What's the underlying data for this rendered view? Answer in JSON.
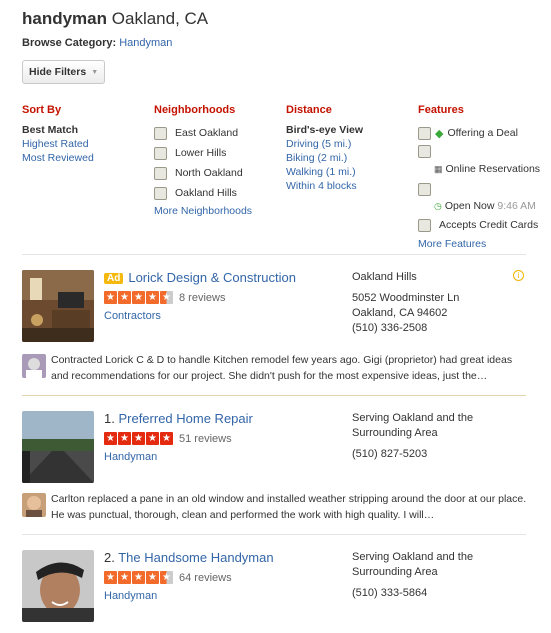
{
  "header": {
    "query": "handyman",
    "location": "Oakland, CA"
  },
  "browse": {
    "label": "Browse Category:",
    "category": "Handyman"
  },
  "hide_filters": {
    "label": "Hide Filters"
  },
  "filters": {
    "sort_by": {
      "heading": "Sort By",
      "items": [
        "Best Match",
        "Highest Rated",
        "Most Reviewed"
      ]
    },
    "neighborhoods": {
      "heading": "Neighborhoods",
      "items": [
        "East Oakland",
        "Lower Hills",
        "North Oakland",
        "Oakland Hills"
      ],
      "more": "More Neighborhoods"
    },
    "distance": {
      "heading": "Distance",
      "items": [
        "Bird's-eye View",
        "Driving (5 mi.)",
        "Biking (2 mi.)",
        "Walking (1 mi.)",
        "Within 4 blocks"
      ]
    },
    "features": {
      "heading": "Features",
      "deal": "Offering a Deal",
      "reservations": "Online Reservations",
      "open_now": "Open Now",
      "open_time": "9:46 AM",
      "credit": "Accepts Credit Cards",
      "more": "More Features"
    }
  },
  "results": [
    {
      "ad": "Ad",
      "number": "",
      "name": "Lorick Design & Construction",
      "rating": 4.5,
      "reviews": "8 reviews",
      "category": "Contractors",
      "neighborhood": "Oakland Hills",
      "address1": "5052 Woodminster Ln",
      "address2": "Oakland, CA 94602",
      "phone": "(510) 336-2508",
      "snippet": "Contracted Lorick C & D to handle Kitchen remodel few years ago.  Gigi (proprietor) had great ideas and recommendations for our project.  She didn't push for the most expensive ideas, just the…"
    },
    {
      "ad": "",
      "number": "1.",
      "name": "Preferred Home Repair",
      "rating": 5,
      "reviews": "51 reviews",
      "category": "Handyman",
      "neighborhood": "Serving Oakland and the Surrounding Area",
      "phone": "(510) 827-5203",
      "snippet": "Carlton replaced a pane in an old window and installed weather stripping around the door at our place.  He was punctual, thorough, clean and performed the work with high quality.   I will…"
    },
    {
      "ad": "",
      "number": "2.",
      "name": "The Handsome Handyman",
      "rating": 4.5,
      "reviews": "64 reviews",
      "category": "Handyman",
      "neighborhood": "Serving Oakland and the Surrounding Area",
      "phone": "(510) 333-5864"
    }
  ],
  "colors": {
    "star_red": "#e42b0f",
    "star_orange": "#f26b2b",
    "heading_red": "#c41200",
    "link_blue": "#3366a8"
  }
}
